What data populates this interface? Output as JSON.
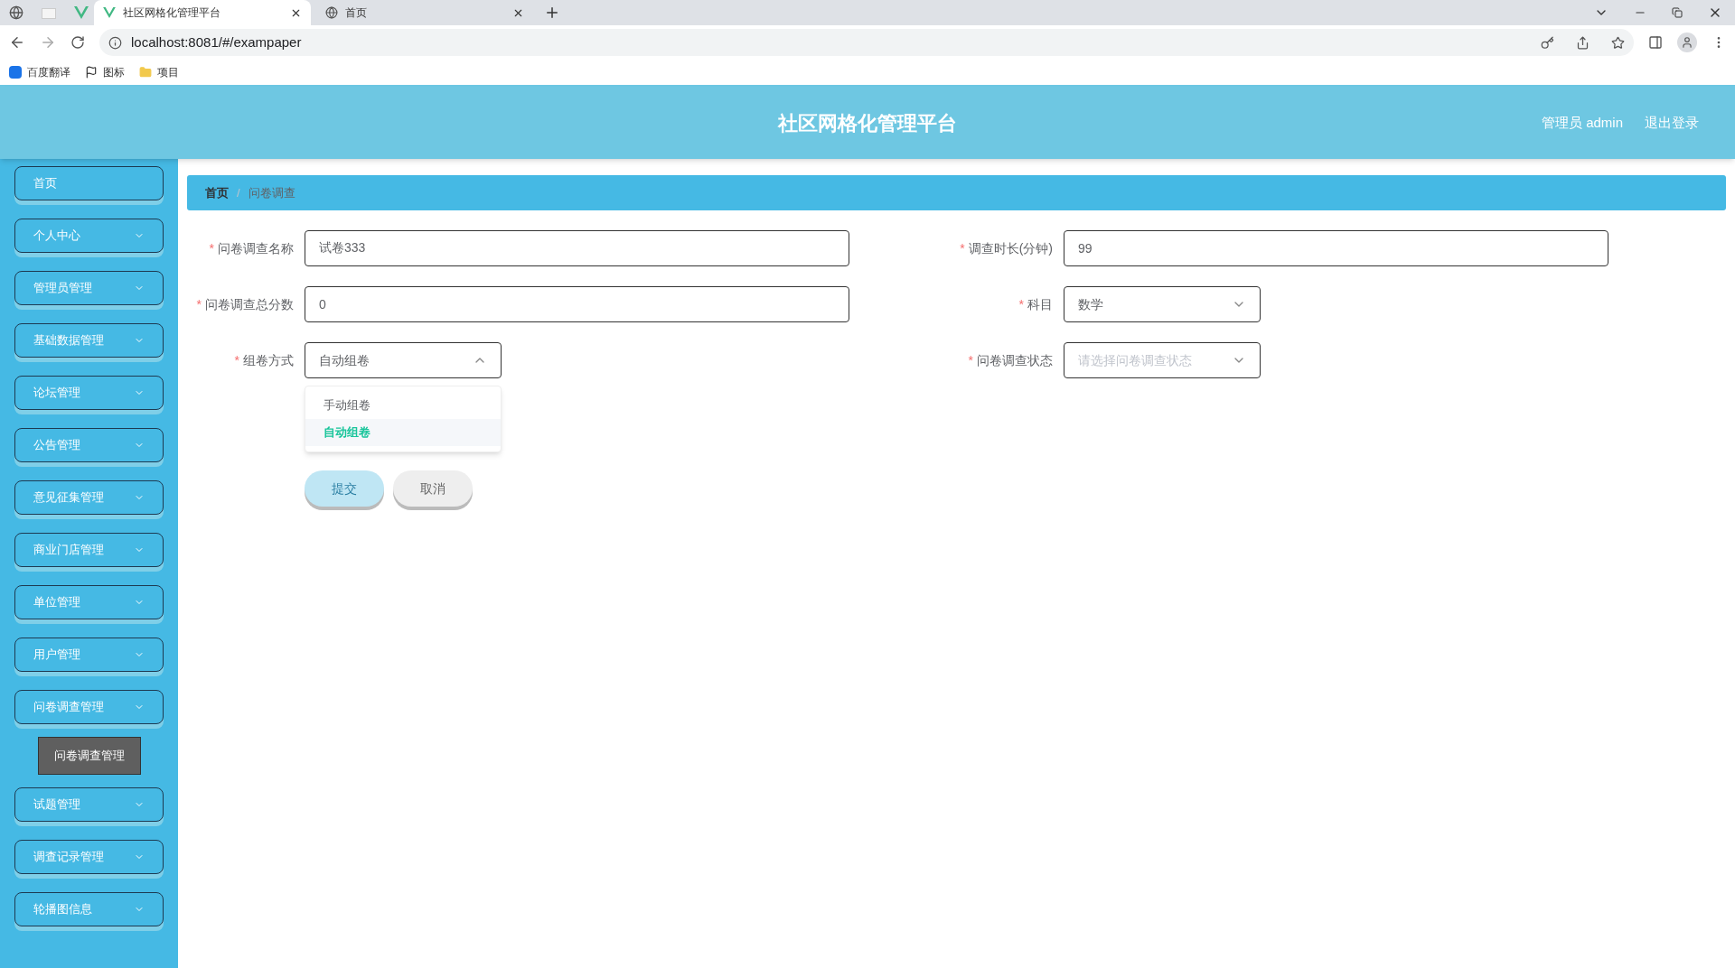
{
  "browser": {
    "tabs": [
      {
        "title": "社区网格化管理平台",
        "selected": true
      },
      {
        "title": "首页",
        "selected": false
      }
    ],
    "url": "localhost:8081/#/exampaper",
    "bookmarks": [
      "百度翻译",
      "图标",
      "项目"
    ]
  },
  "header": {
    "title": "社区网格化管理平台",
    "user": "管理员 admin",
    "logout": "退出登录"
  },
  "sidebar": {
    "items": [
      {
        "label": "首页",
        "expandable": false
      },
      {
        "label": "个人中心",
        "expandable": true
      },
      {
        "label": "管理员管理",
        "expandable": true
      },
      {
        "label": "基础数据管理",
        "expandable": true
      },
      {
        "label": "论坛管理",
        "expandable": true
      },
      {
        "label": "公告管理",
        "expandable": true
      },
      {
        "label": "意见征集管理",
        "expandable": true
      },
      {
        "label": "商业门店管理",
        "expandable": true
      },
      {
        "label": "单位管理",
        "expandable": true
      },
      {
        "label": "用户管理",
        "expandable": true
      },
      {
        "label": "问卷调查管理",
        "expandable": true,
        "children": [
          {
            "label": "问卷调查管理"
          }
        ]
      },
      {
        "label": "试题管理",
        "expandable": true
      },
      {
        "label": "调查记录管理",
        "expandable": true
      },
      {
        "label": "轮播图信息",
        "expandable": true
      }
    ]
  },
  "breadcrumb": {
    "separator": "/",
    "items": [
      "首页",
      "问卷调查"
    ]
  },
  "form": {
    "required_mark": "*",
    "rows": [
      [
        {
          "label": "问卷调查名称",
          "kind": "input",
          "value": "试卷333",
          "required": true
        },
        {
          "label": "调查时长(分钟)",
          "kind": "input",
          "value": "99",
          "required": true
        }
      ],
      [
        {
          "label": "问卷调查总分数",
          "kind": "input",
          "value": "0",
          "required": true
        },
        {
          "label": "科目",
          "kind": "select",
          "value": "数学",
          "required": true,
          "open": false
        }
      ],
      [
        {
          "label": "组卷方式",
          "kind": "select",
          "value": "自动组卷",
          "required": true,
          "open": true,
          "options": [
            {
              "label": "手动组卷",
              "selected": false
            },
            {
              "label": "自动组卷",
              "selected": true
            }
          ]
        },
        {
          "label": "问卷调查状态",
          "kind": "select",
          "placeholder": "请选择问卷调查状态",
          "required": true,
          "open": false
        }
      ]
    ],
    "buttons": [
      "提交",
      "取消"
    ]
  }
}
